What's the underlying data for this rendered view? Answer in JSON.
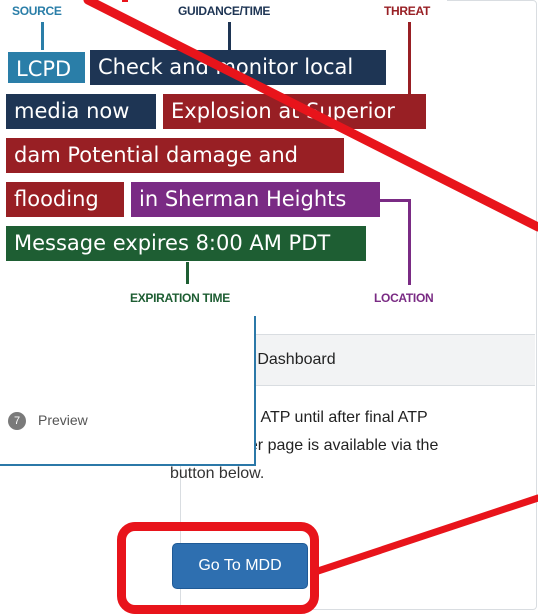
{
  "diagram": {
    "labels": {
      "source": "SOURCE",
      "guidance": "GUIDANCE/TIME",
      "threat": "THREAT",
      "expiration": "EXPIRATION TIME",
      "location": "LOCATION"
    },
    "chips": {
      "source": "LCPD",
      "guidance_line1": "Check and monitor local",
      "guidance_line2": "media now",
      "threat_line1": "Explosion at Superior",
      "threat_line2": "dam Potential damage and",
      "threat_line3": "flooding",
      "location": "in Sherman Heights",
      "expiration": "Message expires 8:00 AM PDT"
    },
    "colors": {
      "source": "#2a7ea8",
      "guidance": "#1e3554",
      "threat": "#981f24",
      "location": "#7a2b84",
      "expiration": "#1e5e33"
    }
  },
  "wizard": {
    "step_number": "7",
    "step_label": "Preview"
  },
  "card": {
    "header": "n Dashboard",
    "body_line1": "ith ATP until after final ATP",
    "body_line2": "der page is available via the",
    "body_line3": "button below.",
    "button_label": "Go To MDD"
  },
  "annotation": {
    "highlight_color": "#e8141b"
  }
}
